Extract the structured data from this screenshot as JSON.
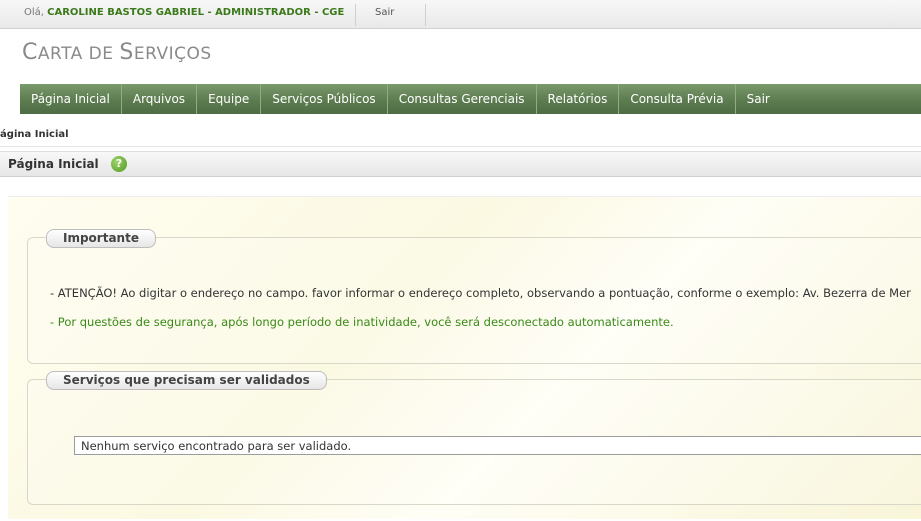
{
  "userbar": {
    "greeting_prefix": "Olá, ",
    "user": "CAROLINE BASTOS GABRIEL - ADMINISTRADOR - CGE",
    "logout_label": "Sair"
  },
  "app_title": {
    "first_letter": "C",
    "rest1": "ARTA DE ",
    "second_letter": "S",
    "rest2": "ERVIÇOS"
  },
  "nav": {
    "items": [
      {
        "label": "Página Inicial"
      },
      {
        "label": "Arquivos"
      },
      {
        "label": "Equipe"
      },
      {
        "label": "Serviços Públicos"
      },
      {
        "label": "Consultas Gerenciais"
      },
      {
        "label": "Relatórios"
      },
      {
        "label": "Consulta Prévia"
      },
      {
        "label": "Sair"
      }
    ],
    "colors": {
      "bar": "#5c7c50",
      "text": "#ffffff"
    }
  },
  "breadcrumb": "Página Inicial",
  "page_header": {
    "title": "Página Inicial",
    "help_icon": "question-circle-icon",
    "help_glyph": "?"
  },
  "important": {
    "legend": "Importante",
    "notice_warning": "- ATENÇÃO! Ao digitar o endereço no campo. favor informar o endereço completo, observando a pontuação, conforme o exemplo: Av. Bezerra de Mer",
    "notice_session": "- Por questões de segurança, após longo período de inatividade, você será desconectado automaticamente."
  },
  "validation": {
    "legend": "Serviços que precisam ser validados",
    "empty_message": "Nenhum serviço encontrado para ser validado."
  }
}
